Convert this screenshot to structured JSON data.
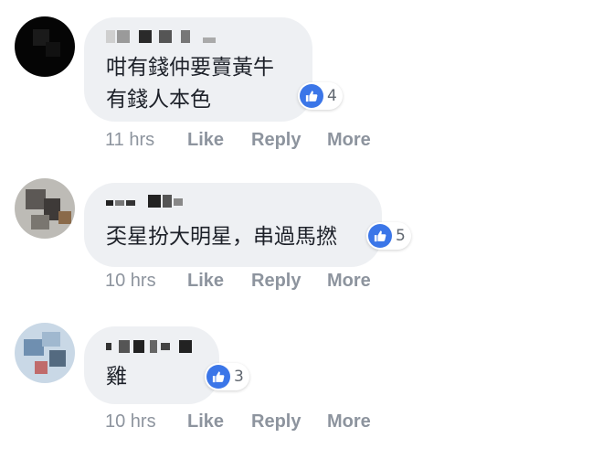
{
  "comments": [
    {
      "text_lines": [
        "咁有錢仲要賣黃牛",
        "有錢人本色"
      ],
      "reaction_icon": "thumbs-up-icon",
      "reaction_count": "4",
      "time": "11 hrs",
      "like_label": "Like",
      "reply_label": "Reply",
      "more_label": "More"
    },
    {
      "text_lines": [
        "奀星扮大明星，串過馬撚"
      ],
      "reaction_icon": "thumbs-up-icon",
      "reaction_count": "5",
      "time": "10 hrs",
      "like_label": "Like",
      "reply_label": "Reply",
      "more_label": "More"
    },
    {
      "text_lines": [
        "雞"
      ],
      "reaction_icon": "thumbs-up-icon",
      "reaction_count": "3",
      "time": "10 hrs",
      "like_label": "Like",
      "reply_label": "Reply",
      "more_label": "More"
    }
  ],
  "colors": {
    "bubble": "#eef0f3",
    "like_blue": "#3b76e8",
    "meta_gray": "#8d949e",
    "text": "#1d2129"
  }
}
